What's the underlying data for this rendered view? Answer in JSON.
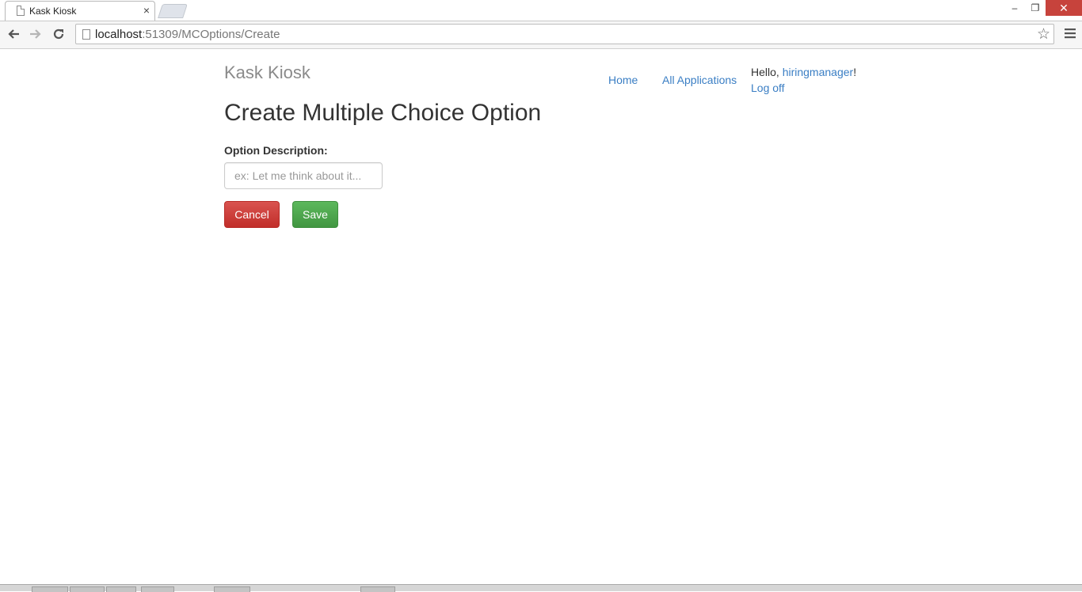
{
  "browser": {
    "tab_title": "Kask Kiosk",
    "tab_close": "×",
    "url_host": "localhost",
    "url_path": ":51309/MCOptions/Create",
    "window_min": "‒",
    "window_restore": "❐",
    "window_close": "✕"
  },
  "header": {
    "brand": "Kask Kiosk",
    "nav": {
      "home": "Home",
      "all_applications": "All Applications"
    },
    "greeting_prefix": "Hello, ",
    "username": "hiringmanager",
    "greeting_suffix": "!",
    "logoff": "Log off"
  },
  "main": {
    "title": "Create Multiple Choice Option",
    "field_label": "Option Description:",
    "field_value": "",
    "field_placeholder": "ex: Let me think about it...",
    "cancel_label": "Cancel",
    "save_label": "Save"
  },
  "colors": {
    "link": "#3a7ec4",
    "cancel": "#d9534f",
    "save": "#5cb85c",
    "brand": "#8a8a8a"
  }
}
